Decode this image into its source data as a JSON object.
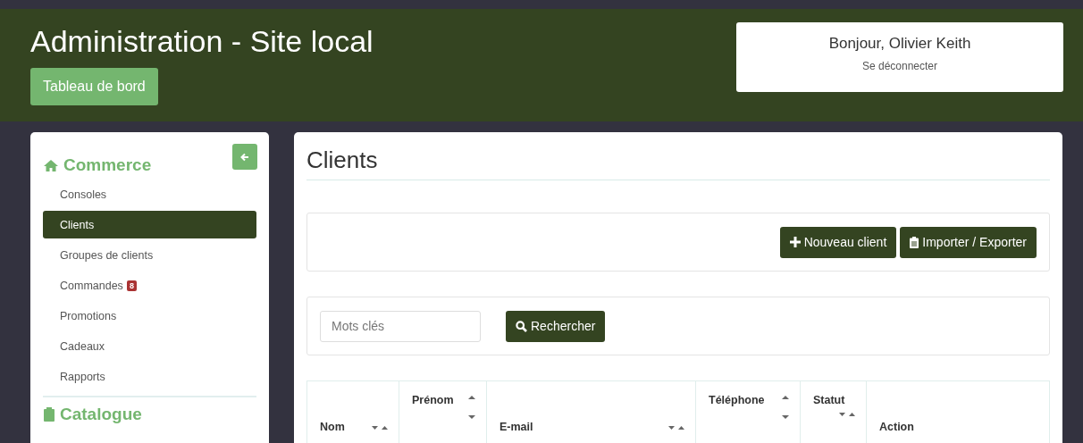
{
  "header": {
    "title": "Administration - Site local",
    "dashboard_button": "Tableau de bord",
    "greeting": "Bonjour, Olivier Keith",
    "logout": "Se déconnecter"
  },
  "sidebar": {
    "sections": [
      {
        "title": "Commerce",
        "items": [
          {
            "label": "Consoles",
            "selected": false
          },
          {
            "label": "Clients",
            "selected": true
          },
          {
            "label": "Groupes de clients",
            "selected": false
          },
          {
            "label": "Commandes",
            "selected": false,
            "badge": "8"
          },
          {
            "label": "Promotions",
            "selected": false
          },
          {
            "label": "Cadeaux",
            "selected": false
          },
          {
            "label": "Rapports",
            "selected": false
          }
        ]
      },
      {
        "title": "Catalogue"
      }
    ]
  },
  "main": {
    "title": "Clients",
    "actions": [
      {
        "label": "Nouveau client"
      },
      {
        "label": "Importer / Exporter"
      }
    ],
    "search": {
      "placeholder": "Mots clés",
      "button": "Rechercher"
    },
    "table": {
      "columns": [
        {
          "label": "Nom",
          "kind": "inline"
        },
        {
          "label": "Prénom",
          "kind": "stacked"
        },
        {
          "label": "E-mail",
          "kind": "inline"
        },
        {
          "label": "Téléphone",
          "kind": "stacked"
        },
        {
          "label": "Statut",
          "kind": "below"
        },
        {
          "label": "Action",
          "kind": "none"
        }
      ]
    }
  }
}
